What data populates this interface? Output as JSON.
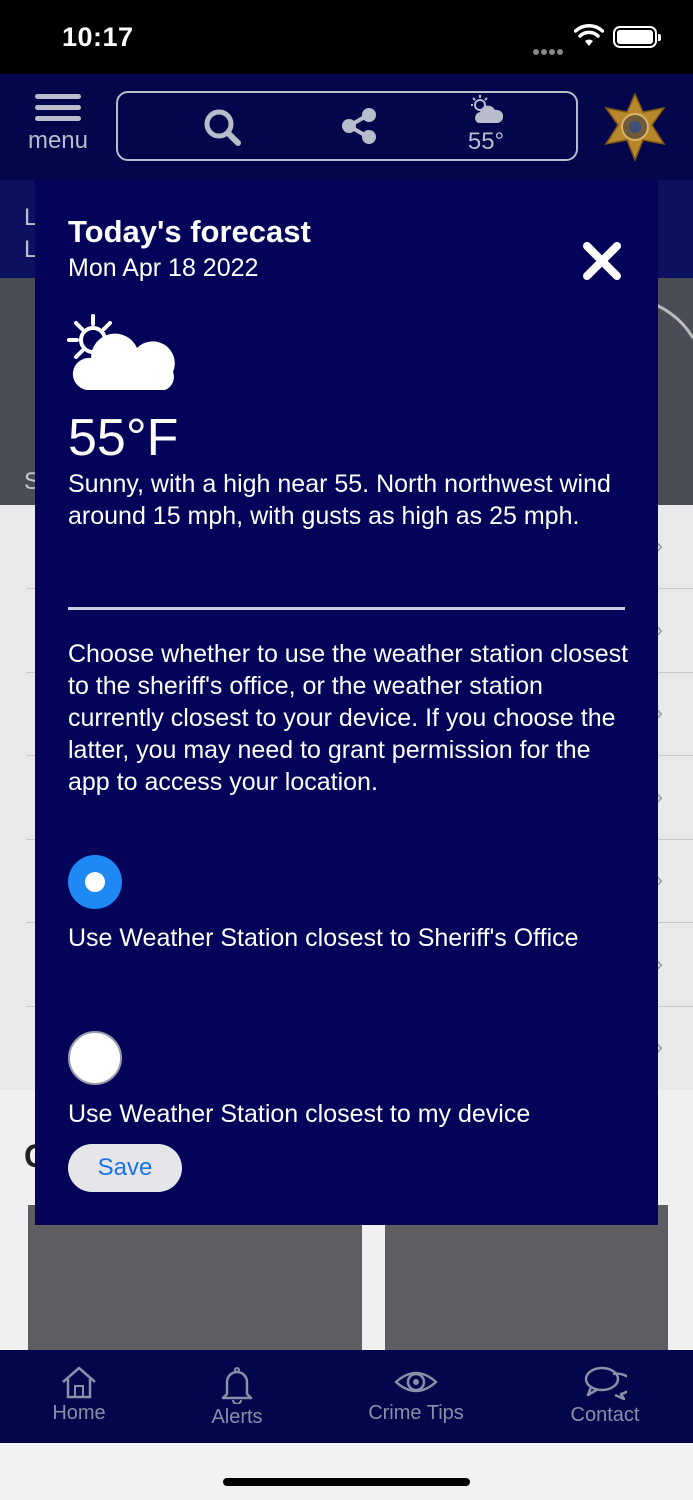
{
  "status_bar": {
    "time": "10:17"
  },
  "header": {
    "menu_label": "menu",
    "weather_temp": "55°"
  },
  "background": {
    "strip_line1": "L",
    "strip_line2": "L",
    "hero_letter": "S",
    "cards_heading": "C"
  },
  "modal": {
    "title": "Today's forecast",
    "date": "Mon Apr 18 2022",
    "temperature": "55°F",
    "description": "Sunny, with a high near 55. North northwest wind around 15 mph, with gusts as high as 25 mph.",
    "info": "Choose whether to use the weather station closest to the sheriff's office, or the weather station currently closest to your device. If you choose the latter, you may need to grant permission for the app to access your location.",
    "options": [
      {
        "label": "Use Weather Station closest to Sheriff's Office",
        "selected": true
      },
      {
        "label": "Use Weather Station closest to my device",
        "selected": false
      }
    ],
    "save_label": "Save"
  },
  "tabbar": {
    "items": [
      {
        "label": "Home",
        "icon": "home-icon"
      },
      {
        "label": "Alerts",
        "icon": "bell-icon"
      },
      {
        "label": "Crime Tips",
        "icon": "eye-icon"
      },
      {
        "label": "Contact",
        "icon": "chat-icon"
      }
    ]
  },
  "colors": {
    "header_bg": "#03064a",
    "modal_bg": "#03035a",
    "radio_selected": "#1e88f5",
    "save_text": "#1a73e8"
  }
}
